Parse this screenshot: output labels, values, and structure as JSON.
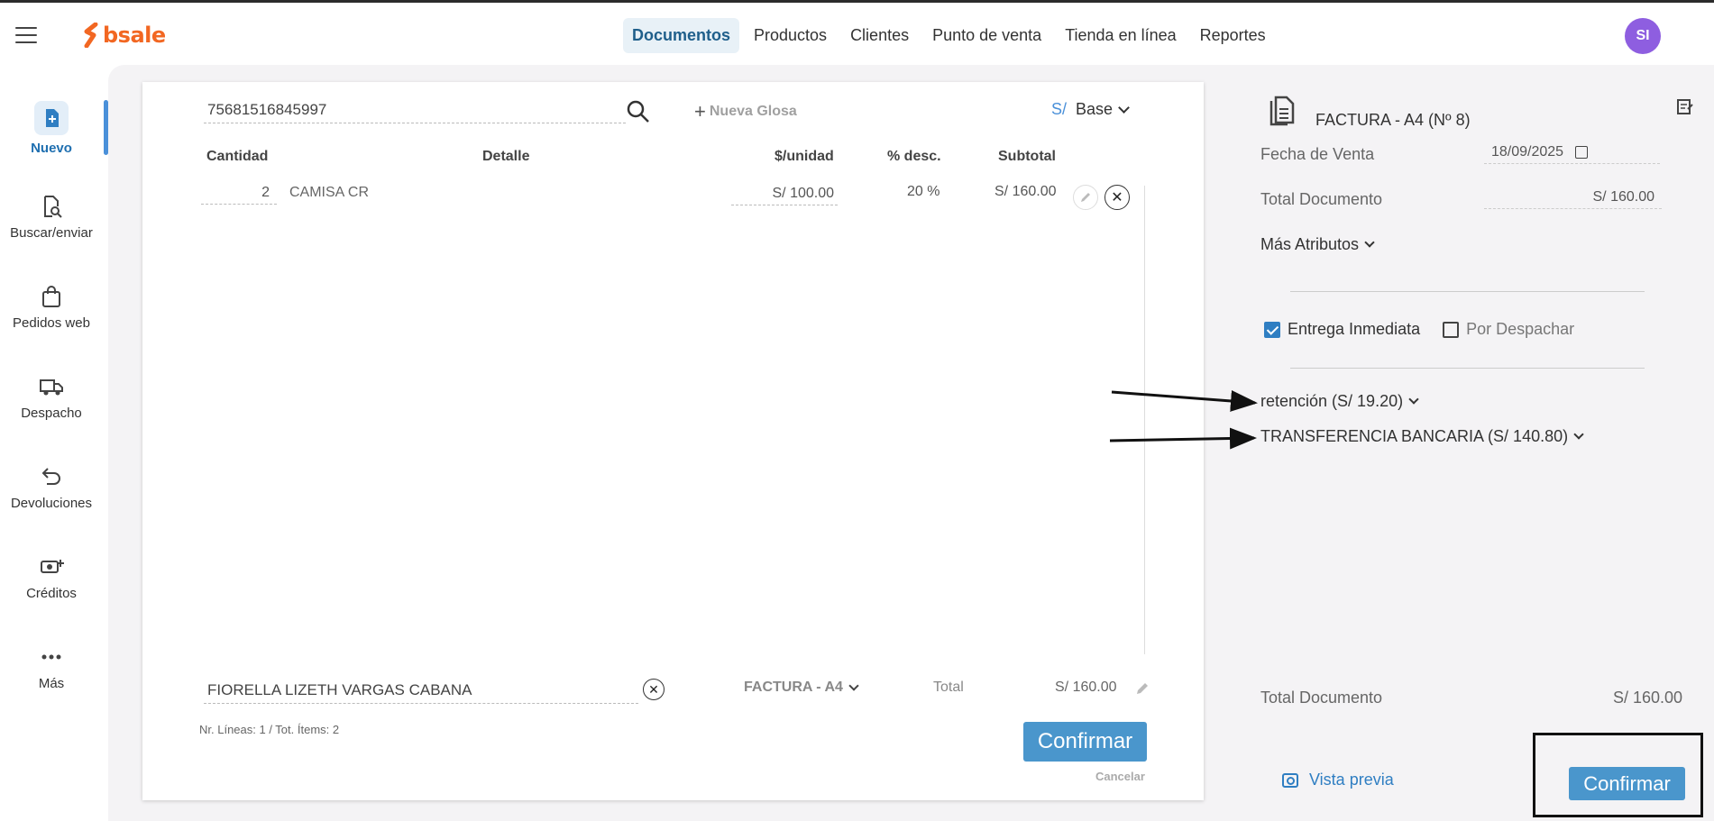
{
  "header": {
    "logo_text": "bsale",
    "nav": [
      "Documentos",
      "Productos",
      "Clientes",
      "Punto de venta",
      "Tienda en línea",
      "Reportes"
    ],
    "active_nav": "Documentos",
    "avatar_initials": "SI"
  },
  "sidebar": {
    "items": [
      {
        "label": "Nuevo",
        "icon": "new-document-icon"
      },
      {
        "label": "Buscar/enviar",
        "icon": "search-document-icon"
      },
      {
        "label": "Pedidos web",
        "icon": "shopping-bag-icon"
      },
      {
        "label": "Despacho",
        "icon": "truck-icon"
      },
      {
        "label": "Devoluciones",
        "icon": "return-arrow-icon"
      },
      {
        "label": "Créditos",
        "icon": "money-add-icon"
      },
      {
        "label": "Más",
        "icon": "more-dots-icon"
      }
    ]
  },
  "document": {
    "code_value": "75681516845997",
    "nueva_glosa": "Nueva Glosa",
    "currency_symbol": "S/",
    "currency_mode": "Base",
    "columns": {
      "cantidad": "Cantidad",
      "detalle": "Detalle",
      "unidad": "$/unidad",
      "desc": "% desc.",
      "subtotal": "Subtotal"
    },
    "line": {
      "qty": "2",
      "detail": "CAMISA CR",
      "price": "S/ 100.00",
      "discount": "20 %",
      "subtotal": "S/ 160.00"
    },
    "client": "FIORELLA LIZETH VARGAS CABANA",
    "doc_type": "FACTURA - A4",
    "total_label": "Total",
    "total_value": "S/ 160.00",
    "counts": "Nr. Líneas: 1 / Tot. Ítems: 2",
    "confirm_label": "Confirmar",
    "cancel_label": "Cancelar"
  },
  "summary": {
    "title": "FACTURA - A4 (Nº 8)",
    "fecha_label": "Fecha de Venta",
    "fecha_value": "18/09/2025",
    "total_doc_label": "Total Documento",
    "total_doc_value": "S/ 160.00",
    "mas_atributos": "Más Atributos",
    "entrega_inmediata": "Entrega Inmediata",
    "entrega_checked": true,
    "por_despachar": "Por Despachar",
    "por_despachar_checked": false,
    "payments": [
      "retención (S/ 19.20)",
      "TRANSFERENCIA BANCARIA (S/ 140.80)"
    ],
    "bottom_total_label": "Total Documento",
    "bottom_total_value": "S/ 160.00",
    "preview_label": "Vista previa",
    "confirm_label": "Confirmar"
  },
  "colors": {
    "brand": "#f26722",
    "accent": "#4a96cc",
    "avatar": "#8e5ee0"
  }
}
